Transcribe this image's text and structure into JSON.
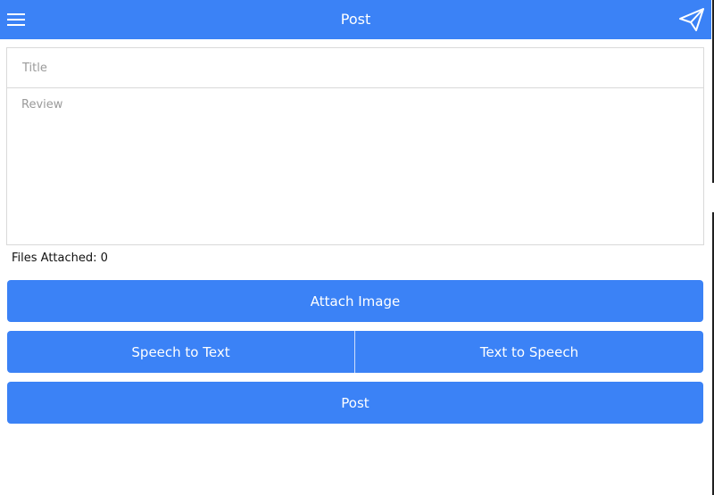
{
  "header": {
    "title": "Post",
    "menu_icon": "hamburger-menu-icon",
    "send_icon": "paper-plane-send-icon",
    "color": "#3b82f6"
  },
  "form": {
    "title_placeholder": "Title",
    "title_value": "",
    "review_placeholder": "Review",
    "review_value": ""
  },
  "files_attached_text": "Files Attached: 0",
  "buttons": {
    "attach_image": "Attach Image",
    "speech_to_text": "Speech to Text",
    "text_to_speech": "Text to Speech",
    "post": "Post"
  }
}
